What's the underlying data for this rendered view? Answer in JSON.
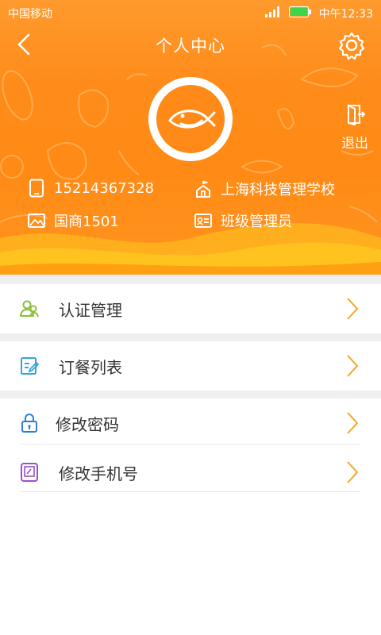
{
  "status_bar": {
    "carrier": "中国移动",
    "time": "中午12:33",
    "network": "4G",
    "battery_color": "#3dd64a"
  },
  "nav": {
    "title": "个人中心",
    "back_icon": "chevron-left-icon",
    "settings_icon": "gear-icon"
  },
  "profile": {
    "avatar_icon": "fish-logo-icon",
    "phone": "15214367328",
    "school": "上海科技管理学校",
    "class_name": "国商1501",
    "role": "班级管理员"
  },
  "logout": {
    "label": "退出",
    "icon": "logout-door-icon"
  },
  "menu": {
    "items": [
      {
        "label": "认证管理",
        "icon": "people-icon",
        "icon_color": "#8bbf3a"
      },
      {
        "label": "订餐列表",
        "icon": "edit-list-icon",
        "icon_color": "#2fa8d8"
      },
      {
        "label": "修改密码",
        "icon": "lock-icon",
        "icon_color": "#2c7fd6"
      },
      {
        "label": "修改手机号",
        "icon": "tablet-icon",
        "icon_color": "#9a4fd0"
      }
    ],
    "chevron_color": "#f5a623"
  },
  "colors": {
    "header_orange": "#ff8c1a",
    "page_bg": "#f0f0f0"
  }
}
